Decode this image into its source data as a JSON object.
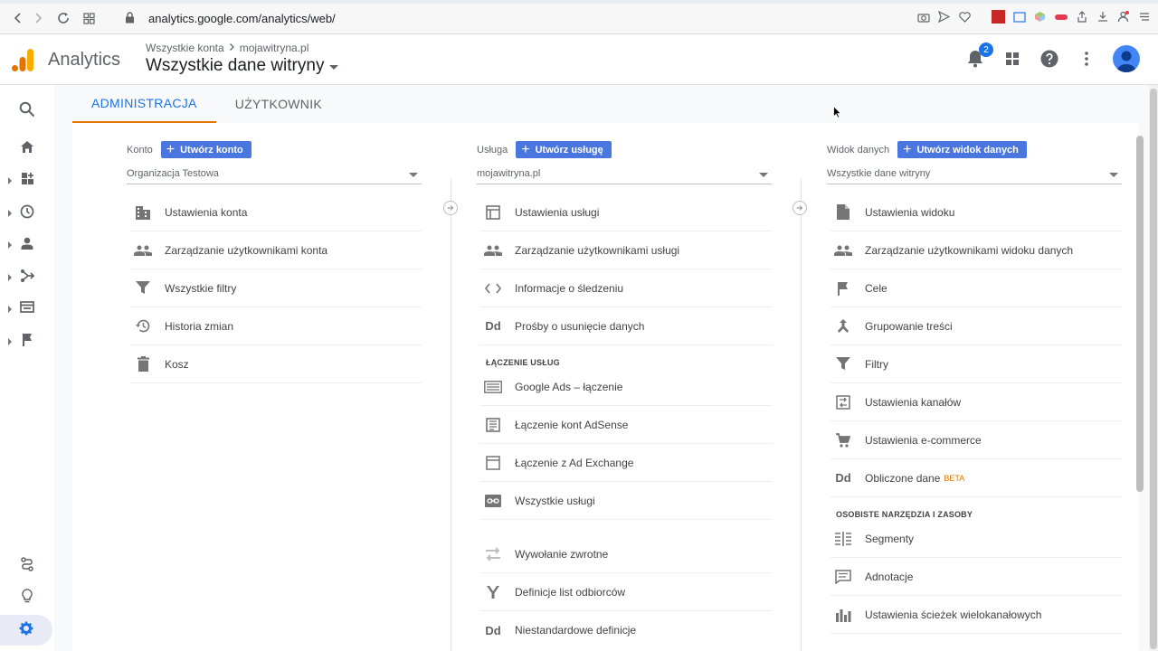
{
  "browser": {
    "url": "analytics.google.com/analytics/web/"
  },
  "header": {
    "app_name": "Analytics",
    "breadcrumb": [
      "Wszystkie konta",
      "mojawitryna.pl"
    ],
    "view_title": "Wszystkie dane witryny",
    "notification_count": "2"
  },
  "tabs": [
    {
      "label": "ADMINISTRACJA",
      "active": true
    },
    {
      "label": "UŻYTKOWNIK",
      "active": false
    }
  ],
  "account": {
    "label": "Konto",
    "create": "Utwórz konto",
    "selected": "Organizacja Testowa",
    "items": [
      {
        "label": "Ustawienia konta",
        "icon": "building-icon"
      },
      {
        "label": "Zarządzanie użytkownikami konta",
        "icon": "people-icon"
      },
      {
        "label": "Wszystkie filtry",
        "icon": "filter-icon"
      },
      {
        "label": "Historia zmian",
        "icon": "history-icon"
      },
      {
        "label": "Kosz",
        "icon": "trash-icon"
      }
    ]
  },
  "property": {
    "label": "Usługa",
    "create": "Utwórz usługę",
    "selected": "mojawitryna.pl",
    "items": [
      {
        "label": "Ustawienia usługi",
        "icon": "window-icon"
      },
      {
        "label": "Zarządzanie użytkownikami usługi",
        "icon": "people-icon"
      },
      {
        "label": "Informacje o śledzeniu",
        "icon": "code-icon"
      },
      {
        "label": "Prośby o usunięcie danych",
        "icon": "dd-icon"
      }
    ],
    "section": "ŁĄCZENIE USŁUG",
    "linking": [
      {
        "label": "Google Ads – łączenie",
        "icon": "ads-icon"
      },
      {
        "label": "Łączenie kont AdSense",
        "icon": "adsense-icon"
      },
      {
        "label": "Łączenie z Ad Exchange",
        "icon": "adexchange-icon"
      },
      {
        "label": "Wszystkie usługi",
        "icon": "link-icon"
      }
    ],
    "more": [
      {
        "label": "Wywołanie zwrotne",
        "icon": "postback-icon"
      },
      {
        "label": "Definicje list odbiorców",
        "icon": "audience-icon"
      },
      {
        "label": "Niestandardowe definicje",
        "icon": "dd-icon"
      }
    ]
  },
  "view": {
    "label": "Widok danych",
    "create": "Utwórz widok danych",
    "selected": "Wszystkie dane witryny",
    "items": [
      {
        "label": "Ustawienia widoku",
        "icon": "document-icon"
      },
      {
        "label": "Zarządzanie użytkownikami widoku danych",
        "icon": "people-icon"
      },
      {
        "label": "Cele",
        "icon": "flag-icon"
      },
      {
        "label": "Grupowanie treści",
        "icon": "grouping-icon"
      },
      {
        "label": "Filtry",
        "icon": "filter-icon"
      },
      {
        "label": "Ustawienia kanałów",
        "icon": "channel-icon"
      },
      {
        "label": "Ustawienia e-commerce",
        "icon": "cart-icon"
      },
      {
        "label": "Obliczone dane",
        "icon": "dd-icon",
        "badge": "BETA"
      }
    ],
    "section": "OSOBISTE NARZĘDZIA I ZASOBY",
    "personal": [
      {
        "label": "Segmenty",
        "icon": "segments-icon"
      },
      {
        "label": "Adnotacje",
        "icon": "annotation-icon"
      },
      {
        "label": "Ustawienia ścieżek wielokanałowych",
        "icon": "bars-icon"
      }
    ]
  },
  "colors": {
    "accent": "#1a73e8",
    "tab_underline": "#e37400",
    "button": "#4a76e0"
  }
}
